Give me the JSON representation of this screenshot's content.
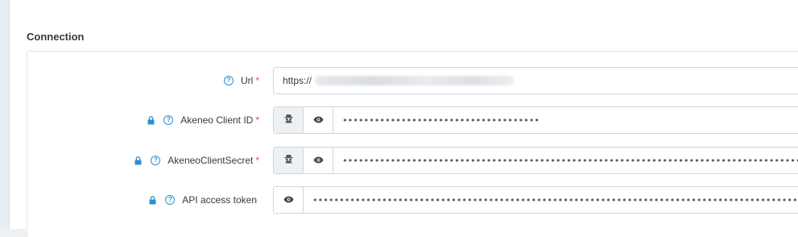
{
  "section": {
    "title": "Connection"
  },
  "fields": [
    {
      "label": "Url",
      "required": "*",
      "value_prefix": "https://",
      "value_masked": ""
    },
    {
      "label": "Akeneo Client ID",
      "required": "*",
      "value_masked": "•••••••••••••••••••••••••••••••••••••"
    },
    {
      "label": "AkeneoClientSecret",
      "required": "*",
      "value_masked": "•••••••••••••••••••••••••••••••••••••••••••••••••••••••••••••••••••••••••••••••••••••••••••••••••"
    },
    {
      "label": "API access token",
      "required": "",
      "value_masked": "••••••••••••••••••••••••••••••••••••••••••••••••••••••••••••••••••••••••••••••••••••••••••••••••••••"
    }
  ],
  "icons": {
    "help": "question-circle-icon",
    "lock": "lock-icon",
    "spy": "incognito-icon",
    "show": "eye-icon"
  },
  "colors": {
    "accent": "#2e8fcf",
    "required": "#d9534f"
  }
}
